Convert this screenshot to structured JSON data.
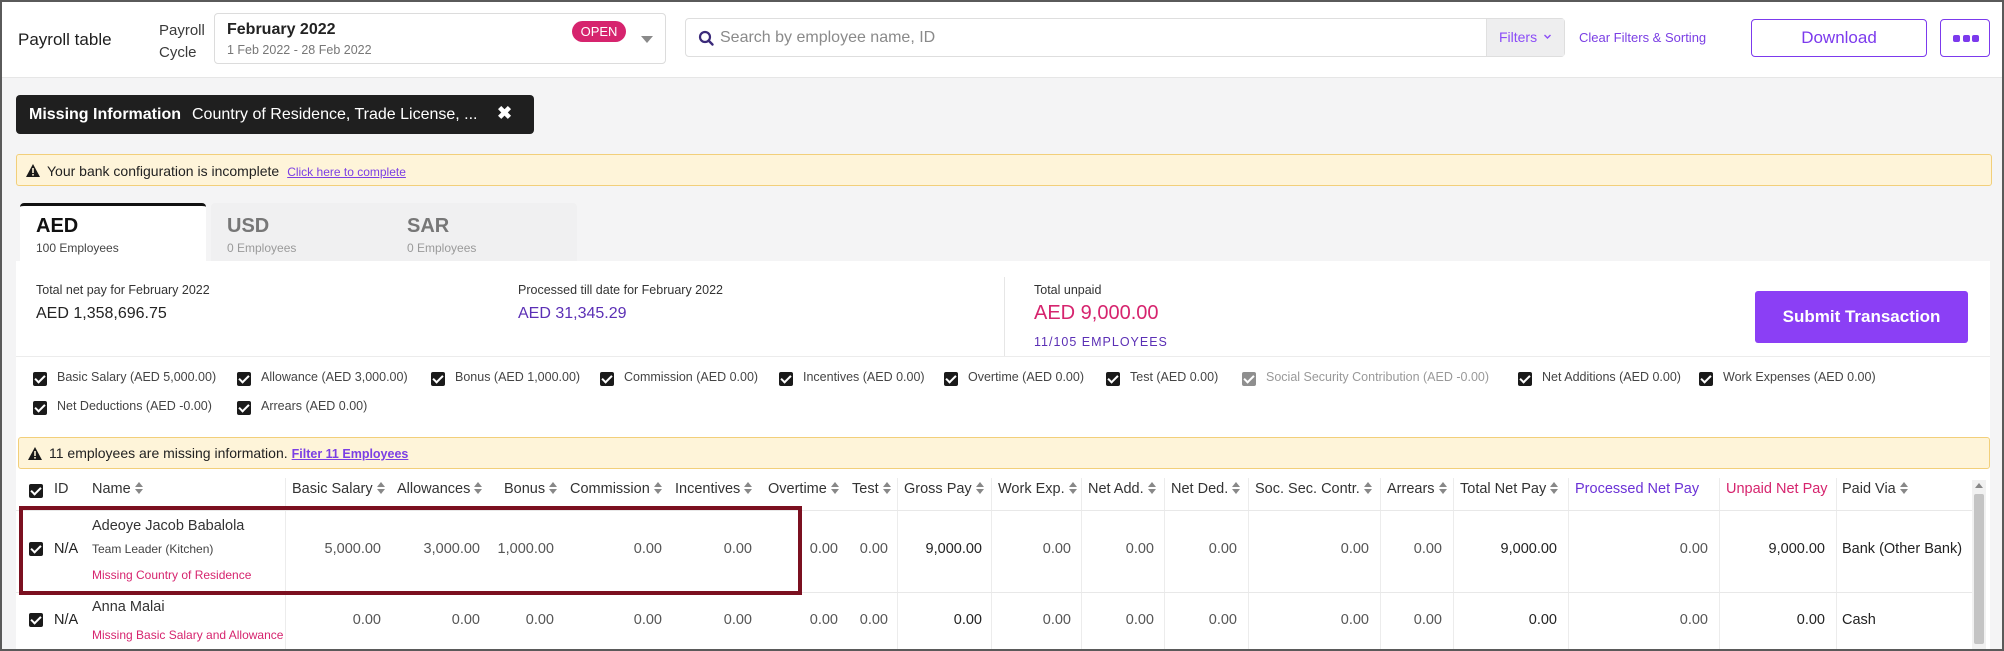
{
  "header": {
    "title": "Payroll table",
    "cycle_label_1": "Payroll",
    "cycle_label_2": "Cycle",
    "cycle_month": "February 2022",
    "cycle_range": "1 Feb 2022 - 28 Feb 2022",
    "cycle_status": "OPEN",
    "search_placeholder": "Search by employee name, ID",
    "filters_label": "Filters",
    "clear_label": "Clear Filters & Sorting",
    "download_label": "Download"
  },
  "missing_filter": {
    "label": "Missing Information",
    "value": "Country of Residence, Trade License, ..."
  },
  "bank_banner": {
    "text": "Your bank configuration is incomplete",
    "link": "Click here to complete"
  },
  "tabs": [
    {
      "code": "AED",
      "employees": "100 Employees",
      "active": true
    },
    {
      "code": "USD",
      "employees": "0 Employees",
      "active": false
    },
    {
      "code": "SAR",
      "employees": "0 Employees",
      "active": false
    }
  ],
  "summary": {
    "net_pay_label": "Total net pay for February 2022",
    "net_pay_value": "AED 1,358,696.75",
    "processed_label": "Processed till date for February 2022",
    "processed_value": "AED 31,345.29",
    "unpaid_label": "Total unpaid",
    "unpaid_value": "AED 9,000.00",
    "unpaid_sub": "11/105 EMPLOYEES",
    "submit_label": "Submit Transaction"
  },
  "components": [
    {
      "label": "Basic Salary (AED 5,000.00)",
      "enabled": true
    },
    {
      "label": "Allowance (AED 3,000.00)",
      "enabled": true
    },
    {
      "label": "Bonus (AED 1,000.00)",
      "enabled": true
    },
    {
      "label": "Commission (AED 0.00)",
      "enabled": true
    },
    {
      "label": "Incentives (AED 0.00)",
      "enabled": true
    },
    {
      "label": "Overtime (AED 0.00)",
      "enabled": true
    },
    {
      "label": "Test (AED 0.00)",
      "enabled": true
    },
    {
      "label": "Social Security Contribution (AED -0.00)",
      "enabled": false
    },
    {
      "label": "Net Additions (AED 0.00)",
      "enabled": true
    },
    {
      "label": "Work Expenses (AED 0.00)",
      "enabled": true
    },
    {
      "label": "Net Deductions (AED -0.00)",
      "enabled": true
    },
    {
      "label": "Arrears (AED 0.00)",
      "enabled": true
    }
  ],
  "missing_banner": {
    "text": "11 employees are missing information.",
    "link": "Filter 11 Employees"
  },
  "table": {
    "headers": [
      "ID",
      "Name",
      "Basic Salary",
      "Allowances",
      "Bonus",
      "Commission",
      "Incentives",
      "Overtime",
      "Test",
      "Gross Pay",
      "Work Exp.",
      "Net Add.",
      "Net Ded.",
      "Soc. Sec. Contr.",
      "Arrears",
      "Total Net Pay",
      "Processed Net Pay",
      "Unpaid Net Pay",
      "Paid Via"
    ],
    "rows": [
      {
        "id": "N/A",
        "name": "Adeoye Jacob Babalola",
        "role": "Team Leader (Kitchen)",
        "missing": "Missing Country of Residence",
        "values": [
          "5,000.00",
          "3,000.00",
          "1,000.00",
          "0.00",
          "0.00",
          "0.00",
          "0.00",
          "9,000.00",
          "0.00",
          "0.00",
          "0.00",
          "0.00",
          "0.00",
          "9,000.00",
          "0.00",
          "9,000.00"
        ],
        "paid_via": "Bank (Other Bank)"
      },
      {
        "id": "N/A",
        "name": "Anna Malai",
        "role": "",
        "missing": "Missing Basic Salary and Allowance",
        "values": [
          "0.00",
          "0.00",
          "0.00",
          "0.00",
          "0.00",
          "0.00",
          "0.00",
          "0.00",
          "0.00",
          "0.00",
          "0.00",
          "0.00",
          "0.00",
          "0.00",
          "0.00",
          "0.00"
        ],
        "paid_via": "Cash"
      }
    ]
  },
  "colors": {
    "accent": "#8b3ff5",
    "pink": "#d6246e",
    "highlight": "#7b1020"
  }
}
